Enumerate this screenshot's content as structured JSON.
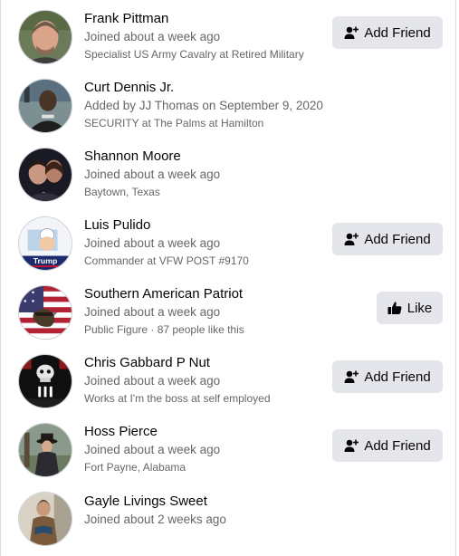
{
  "members": [
    {
      "name": "Frank Pittman",
      "joined": "Joined about a week ago",
      "detail": "Specialist US Army Cavalry at Retired Military",
      "action": "Add Friend",
      "action_icon": "add-friend-icon"
    },
    {
      "name": "Curt Dennis Jr.",
      "joined": "Added by JJ Thomas on September 9, 2020",
      "detail": "SECURITY at The Palms at Hamilton",
      "action": null,
      "action_icon": null
    },
    {
      "name": "Shannon Moore",
      "joined": "Joined about a week ago",
      "detail": "Baytown, Texas",
      "action": null,
      "action_icon": null
    },
    {
      "name": "Luis Pulido",
      "joined": "Joined about a week ago",
      "detail": "Commander at VFW POST #9170",
      "action": "Add Friend",
      "action_icon": "add-friend-icon",
      "avatar_text": "Trump"
    },
    {
      "name": "Southern American Patriot",
      "joined": "Joined about a week ago",
      "detail": "Public Figure · 87 people like this",
      "action": "Like",
      "action_icon": "thumbs-up-icon"
    },
    {
      "name": "Chris Gabbard P Nut",
      "joined": "Joined about a week ago",
      "detail": "Works at I'm the boss at self employed",
      "action": "Add Friend",
      "action_icon": "add-friend-icon"
    },
    {
      "name": "Hoss Pierce",
      "joined": "Joined about a week ago",
      "detail": "Fort Payne, Alabama",
      "action": "Add Friend",
      "action_icon": "add-friend-icon"
    },
    {
      "name": "Gayle Livings Sweet",
      "joined": "Joined about 2 weeks ago",
      "detail": null,
      "action": null,
      "action_icon": null
    }
  ],
  "colors": {
    "primary_text": "#050505",
    "secondary_text": "#65676b",
    "button_bg": "#e4e6eb"
  }
}
